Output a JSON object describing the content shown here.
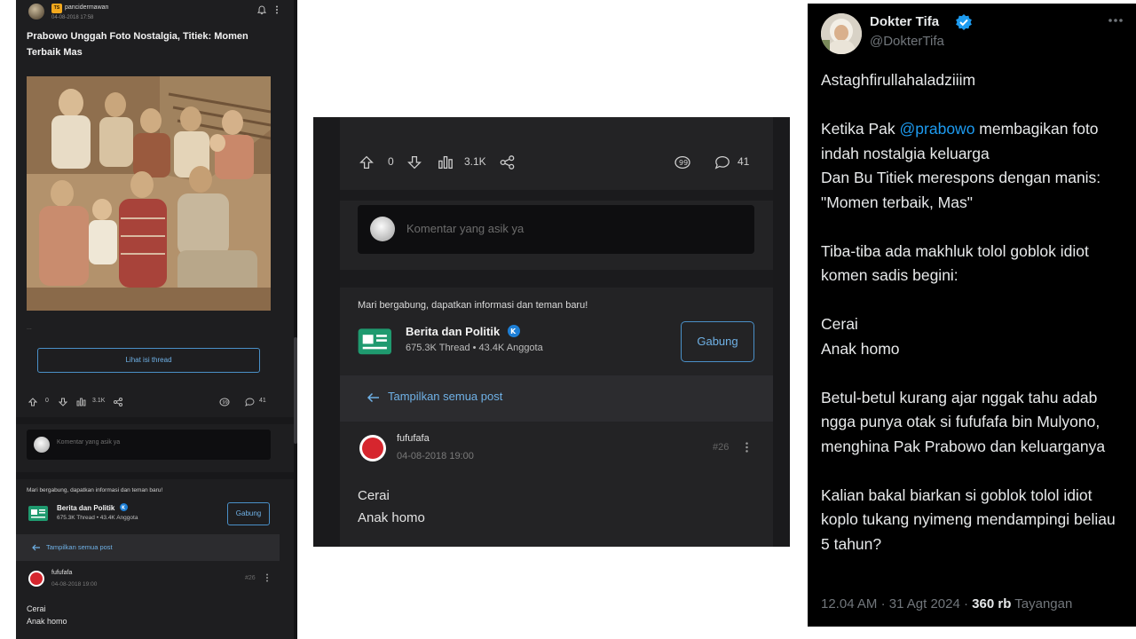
{
  "left_panel": {
    "author": {
      "badge": "TS",
      "username": "pancidermawan",
      "date": "04-08-2018 17:58"
    },
    "thread_title": "Prabowo Unggah Foto Nostalgia, Titiek: Momen Terbaik Mas",
    "ellipsis": "...",
    "view_thread_label": "Lihat isi thread",
    "stats": {
      "upvotes": "0",
      "views": "3.1K",
      "comments": "41"
    },
    "comment_placeholder": "Komentar yang asik ya",
    "join_prompt": "Mari bergabung, dapatkan informasi dan teman baru!",
    "community": {
      "name": "Berita dan Politik",
      "threads": "675.3K Thread",
      "members": "43.4K Anggota",
      "join_label": "Gabung"
    },
    "show_all_posts_label": "Tampilkan semua post",
    "reply": {
      "username": "fufufafa",
      "date": "04-08-2018 19:00",
      "post_number": "#26",
      "lines": [
        "Cerai",
        "Anak homo"
      ]
    }
  },
  "middle_panel": {
    "stats": {
      "upvotes": "0",
      "views": "3.1K",
      "comments": "41"
    },
    "comment_placeholder": "Komentar yang asik ya",
    "join_prompt": "Mari bergabung, dapatkan informasi dan teman baru!",
    "community": {
      "name": "Berita dan Politik",
      "threads": "675.3K Thread",
      "members": "43.4K Anggota",
      "join_label": "Gabung"
    },
    "show_all_posts_label": "Tampilkan semua post",
    "reply": {
      "username": "fufufafa",
      "date": "04-08-2018 19:00",
      "post_number": "#26",
      "lines": [
        "Cerai",
        "Anak homo"
      ]
    }
  },
  "right_panel": {
    "display_name": "Dokter Tifa",
    "handle": "@DokterTifa",
    "paragraphs": {
      "p1": "Astaghfirullahaladziiim",
      "p2_before": "Ketika Pak ",
      "p2_mention": "@prabowo",
      "p2_after": " membagikan foto indah nostalgia keluarga\nDan Bu Titiek merespons dengan manis: \"Momen terbaik, Mas\"",
      "p3": "Tiba-tiba ada makhluk tolol goblok idiot komen sadis begini:",
      "p4": "Cerai\nAnak homo",
      "p5": "Betul-betul kurang ajar nggak tahu adab ngga punya otak   si fufufafa bin Mulyono, menghina Pak Prabowo dan keluarganya",
      "p6": "Kalian bakal biarkan si  goblok tolol idiot koplo tukang nyimeng mendampingi beliau 5 tahun?"
    },
    "time": "12.04 AM",
    "separator": "·",
    "date": "31 Agt 2024",
    "views_count": "360 rb",
    "views_label": "Tayangan"
  },
  "colors": {
    "link_blue": "#1d9bf0",
    "kaskus_blue": "#6fb1e6",
    "verified": "#1d9bf0",
    "badge_orange": "#f2a81d"
  },
  "icons": [
    "bell-icon",
    "kebab-icon",
    "upvote-icon",
    "downvote-icon",
    "views-icon",
    "share-icon",
    "quote-icon",
    "comment-icon",
    "back-arrow-icon",
    "verified-icon",
    "more-icon",
    "community-icon"
  ]
}
